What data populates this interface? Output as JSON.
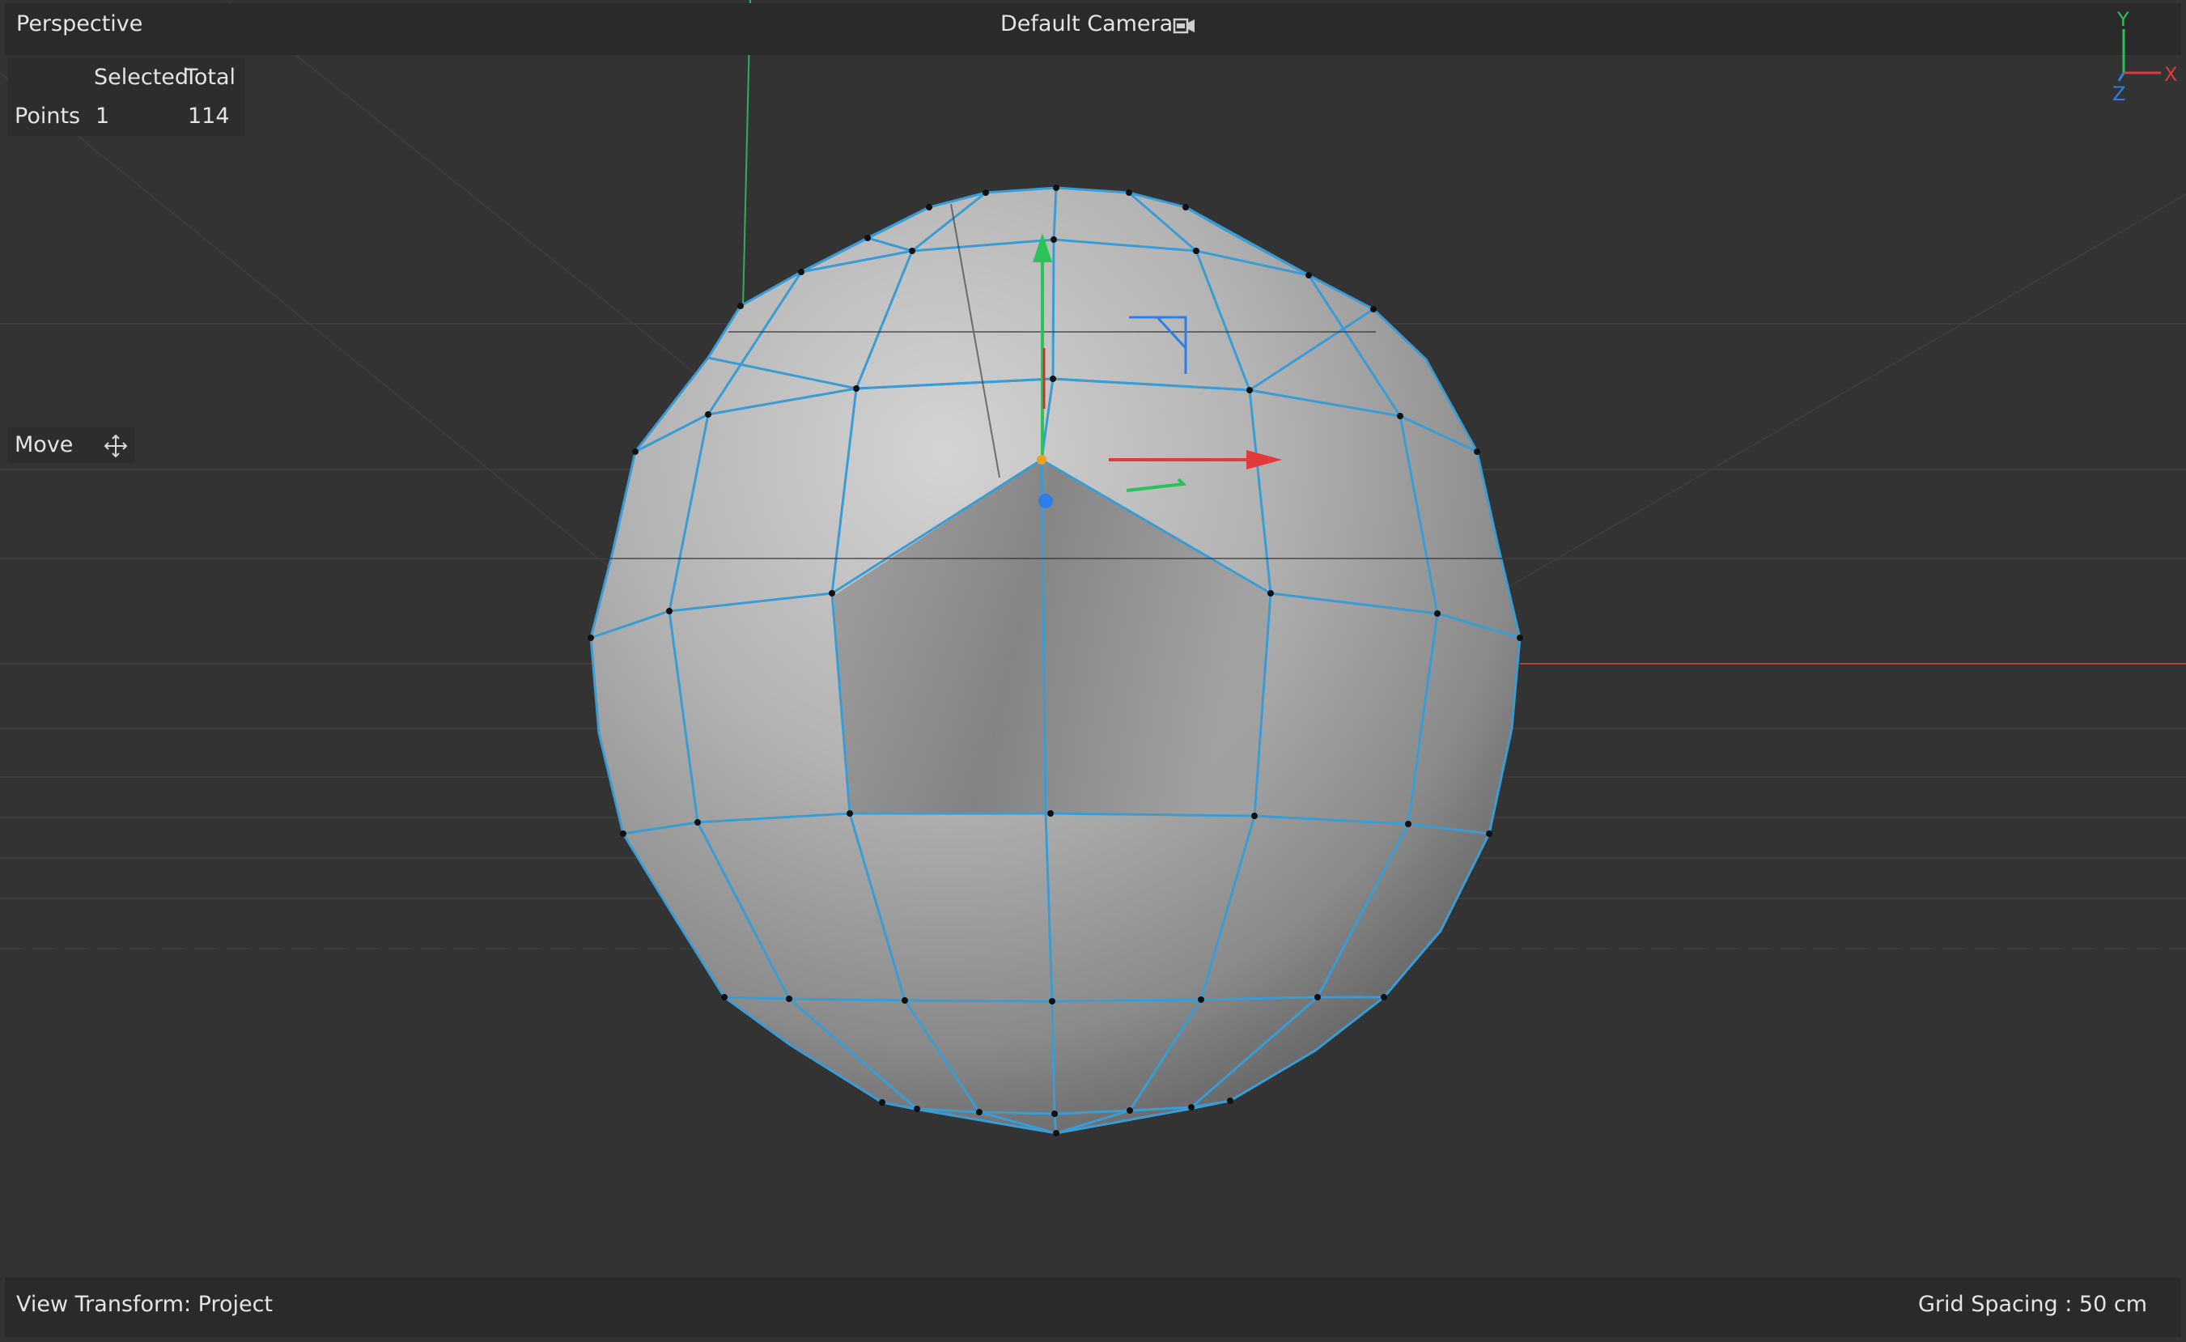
{
  "viewport": {
    "view_name": "Perspective",
    "camera_name": "Default Camera",
    "camera_icon": "camera-icon",
    "stats": {
      "col_selected": "Selected",
      "col_total": "Total",
      "row_label": "Points",
      "selected": "1",
      "total": "114"
    },
    "tool": {
      "label": "Move",
      "icon": "move-icon"
    },
    "axis": {
      "y": "Y",
      "x": "X",
      "z": "Z"
    },
    "footer": {
      "view_transform": "View Transform: Project",
      "grid_spacing": "Grid Spacing : 50 cm"
    }
  },
  "colors": {
    "background": "#333333",
    "bar": "#2a2a2a",
    "wireframe": "#3a9cd4",
    "axis_x": "#e23a3a",
    "axis_y": "#29c35a",
    "axis_z": "#2f7de8",
    "pivot": "#f0a020"
  }
}
